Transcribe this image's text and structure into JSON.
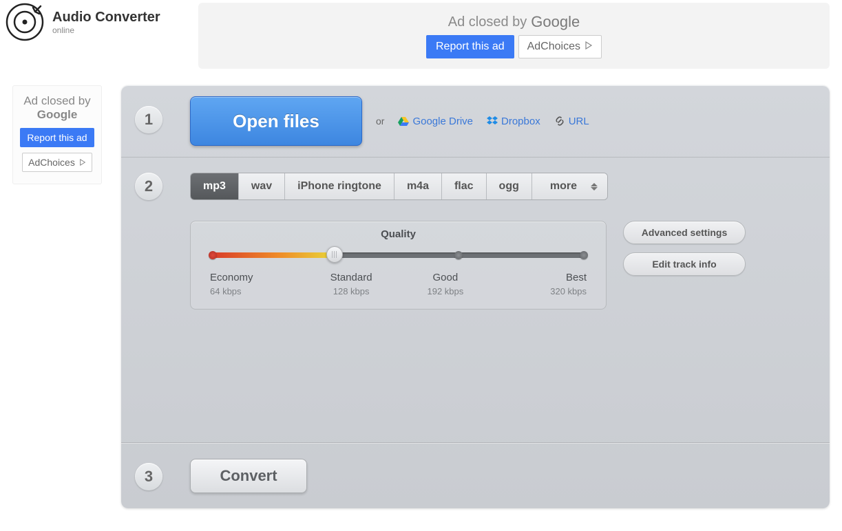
{
  "header": {
    "title": "Audio Converter",
    "subtitle": "online"
  },
  "ad": {
    "closed_by": "Ad closed by",
    "google": "Google",
    "report": "Report this ad",
    "adchoices": "AdChoices"
  },
  "step1": {
    "num": "1",
    "open": "Open files",
    "or": "or",
    "gdrive": "Google Drive",
    "dropbox": "Dropbox",
    "url": "URL"
  },
  "step2": {
    "num": "2",
    "tabs": [
      "mp3",
      "wav",
      "iPhone ringtone",
      "m4a",
      "flac",
      "ogg"
    ],
    "more": "more",
    "quality_title": "Quality",
    "levels": [
      {
        "name": "Economy",
        "rate": "64 kbps"
      },
      {
        "name": "Standard",
        "rate": "128 kbps"
      },
      {
        "name": "Good",
        "rate": "192 kbps"
      },
      {
        "name": "Best",
        "rate": "320 kbps"
      }
    ],
    "advanced": "Advanced settings",
    "edit_info": "Edit track info"
  },
  "step3": {
    "num": "3",
    "convert": "Convert"
  }
}
